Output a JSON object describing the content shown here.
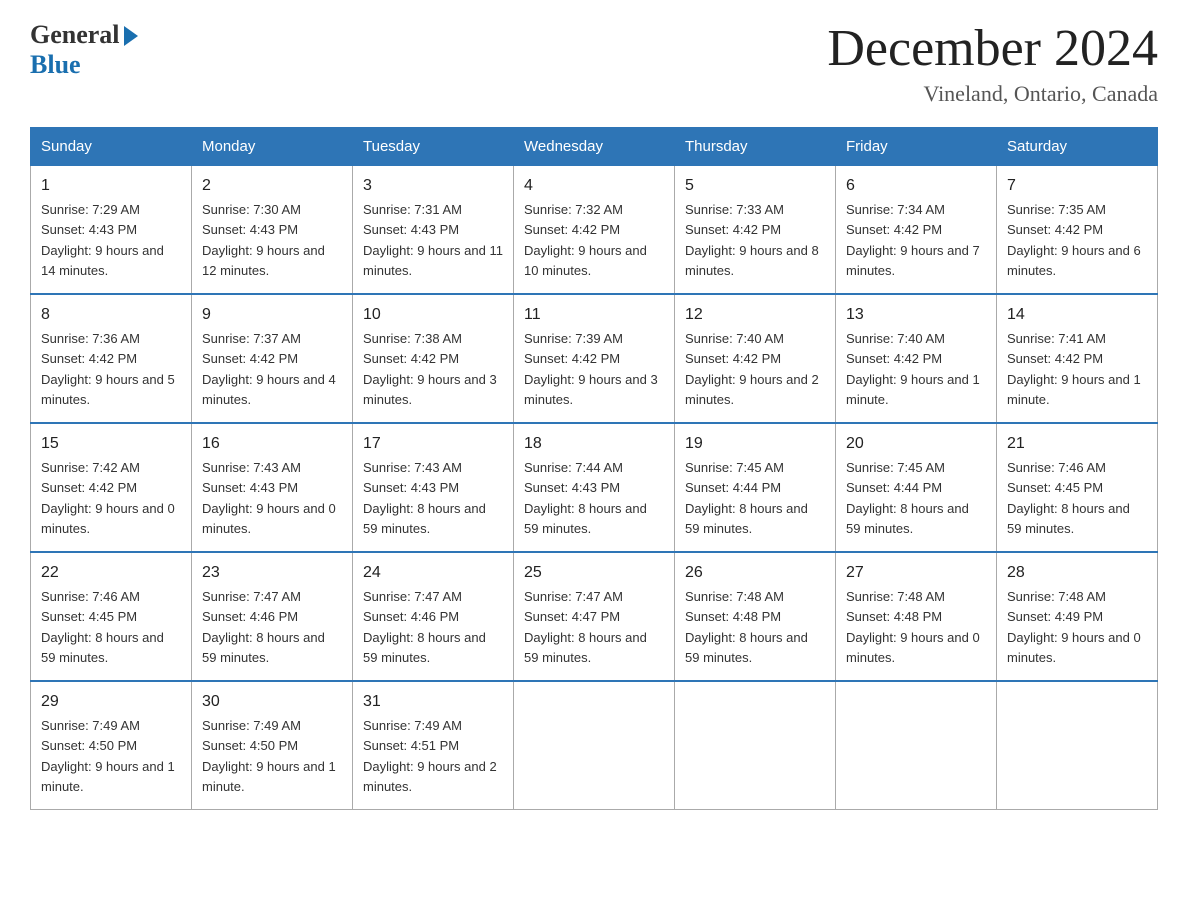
{
  "logo": {
    "general": "General",
    "blue": "Blue"
  },
  "title": "December 2024",
  "location": "Vineland, Ontario, Canada",
  "days_header": [
    "Sunday",
    "Monday",
    "Tuesday",
    "Wednesday",
    "Thursday",
    "Friday",
    "Saturday"
  ],
  "weeks": [
    [
      {
        "day": "1",
        "sunrise": "7:29 AM",
        "sunset": "4:43 PM",
        "daylight": "9 hours and 14 minutes."
      },
      {
        "day": "2",
        "sunrise": "7:30 AM",
        "sunset": "4:43 PM",
        "daylight": "9 hours and 12 minutes."
      },
      {
        "day": "3",
        "sunrise": "7:31 AM",
        "sunset": "4:43 PM",
        "daylight": "9 hours and 11 minutes."
      },
      {
        "day": "4",
        "sunrise": "7:32 AM",
        "sunset": "4:42 PM",
        "daylight": "9 hours and 10 minutes."
      },
      {
        "day": "5",
        "sunrise": "7:33 AM",
        "sunset": "4:42 PM",
        "daylight": "9 hours and 8 minutes."
      },
      {
        "day": "6",
        "sunrise": "7:34 AM",
        "sunset": "4:42 PM",
        "daylight": "9 hours and 7 minutes."
      },
      {
        "day": "7",
        "sunrise": "7:35 AM",
        "sunset": "4:42 PM",
        "daylight": "9 hours and 6 minutes."
      }
    ],
    [
      {
        "day": "8",
        "sunrise": "7:36 AM",
        "sunset": "4:42 PM",
        "daylight": "9 hours and 5 minutes."
      },
      {
        "day": "9",
        "sunrise": "7:37 AM",
        "sunset": "4:42 PM",
        "daylight": "9 hours and 4 minutes."
      },
      {
        "day": "10",
        "sunrise": "7:38 AM",
        "sunset": "4:42 PM",
        "daylight": "9 hours and 3 minutes."
      },
      {
        "day": "11",
        "sunrise": "7:39 AM",
        "sunset": "4:42 PM",
        "daylight": "9 hours and 3 minutes."
      },
      {
        "day": "12",
        "sunrise": "7:40 AM",
        "sunset": "4:42 PM",
        "daylight": "9 hours and 2 minutes."
      },
      {
        "day": "13",
        "sunrise": "7:40 AM",
        "sunset": "4:42 PM",
        "daylight": "9 hours and 1 minute."
      },
      {
        "day": "14",
        "sunrise": "7:41 AM",
        "sunset": "4:42 PM",
        "daylight": "9 hours and 1 minute."
      }
    ],
    [
      {
        "day": "15",
        "sunrise": "7:42 AM",
        "sunset": "4:42 PM",
        "daylight": "9 hours and 0 minutes."
      },
      {
        "day": "16",
        "sunrise": "7:43 AM",
        "sunset": "4:43 PM",
        "daylight": "9 hours and 0 minutes."
      },
      {
        "day": "17",
        "sunrise": "7:43 AM",
        "sunset": "4:43 PM",
        "daylight": "8 hours and 59 minutes."
      },
      {
        "day": "18",
        "sunrise": "7:44 AM",
        "sunset": "4:43 PM",
        "daylight": "8 hours and 59 minutes."
      },
      {
        "day": "19",
        "sunrise": "7:45 AM",
        "sunset": "4:44 PM",
        "daylight": "8 hours and 59 minutes."
      },
      {
        "day": "20",
        "sunrise": "7:45 AM",
        "sunset": "4:44 PM",
        "daylight": "8 hours and 59 minutes."
      },
      {
        "day": "21",
        "sunrise": "7:46 AM",
        "sunset": "4:45 PM",
        "daylight": "8 hours and 59 minutes."
      }
    ],
    [
      {
        "day": "22",
        "sunrise": "7:46 AM",
        "sunset": "4:45 PM",
        "daylight": "8 hours and 59 minutes."
      },
      {
        "day": "23",
        "sunrise": "7:47 AM",
        "sunset": "4:46 PM",
        "daylight": "8 hours and 59 minutes."
      },
      {
        "day": "24",
        "sunrise": "7:47 AM",
        "sunset": "4:46 PM",
        "daylight": "8 hours and 59 minutes."
      },
      {
        "day": "25",
        "sunrise": "7:47 AM",
        "sunset": "4:47 PM",
        "daylight": "8 hours and 59 minutes."
      },
      {
        "day": "26",
        "sunrise": "7:48 AM",
        "sunset": "4:48 PM",
        "daylight": "8 hours and 59 minutes."
      },
      {
        "day": "27",
        "sunrise": "7:48 AM",
        "sunset": "4:48 PM",
        "daylight": "9 hours and 0 minutes."
      },
      {
        "day": "28",
        "sunrise": "7:48 AM",
        "sunset": "4:49 PM",
        "daylight": "9 hours and 0 minutes."
      }
    ],
    [
      {
        "day": "29",
        "sunrise": "7:49 AM",
        "sunset": "4:50 PM",
        "daylight": "9 hours and 1 minute."
      },
      {
        "day": "30",
        "sunrise": "7:49 AM",
        "sunset": "4:50 PM",
        "daylight": "9 hours and 1 minute."
      },
      {
        "day": "31",
        "sunrise": "7:49 AM",
        "sunset": "4:51 PM",
        "daylight": "9 hours and 2 minutes."
      },
      null,
      null,
      null,
      null
    ]
  ],
  "labels": {
    "sunrise": "Sunrise:",
    "sunset": "Sunset:",
    "daylight": "Daylight:"
  }
}
